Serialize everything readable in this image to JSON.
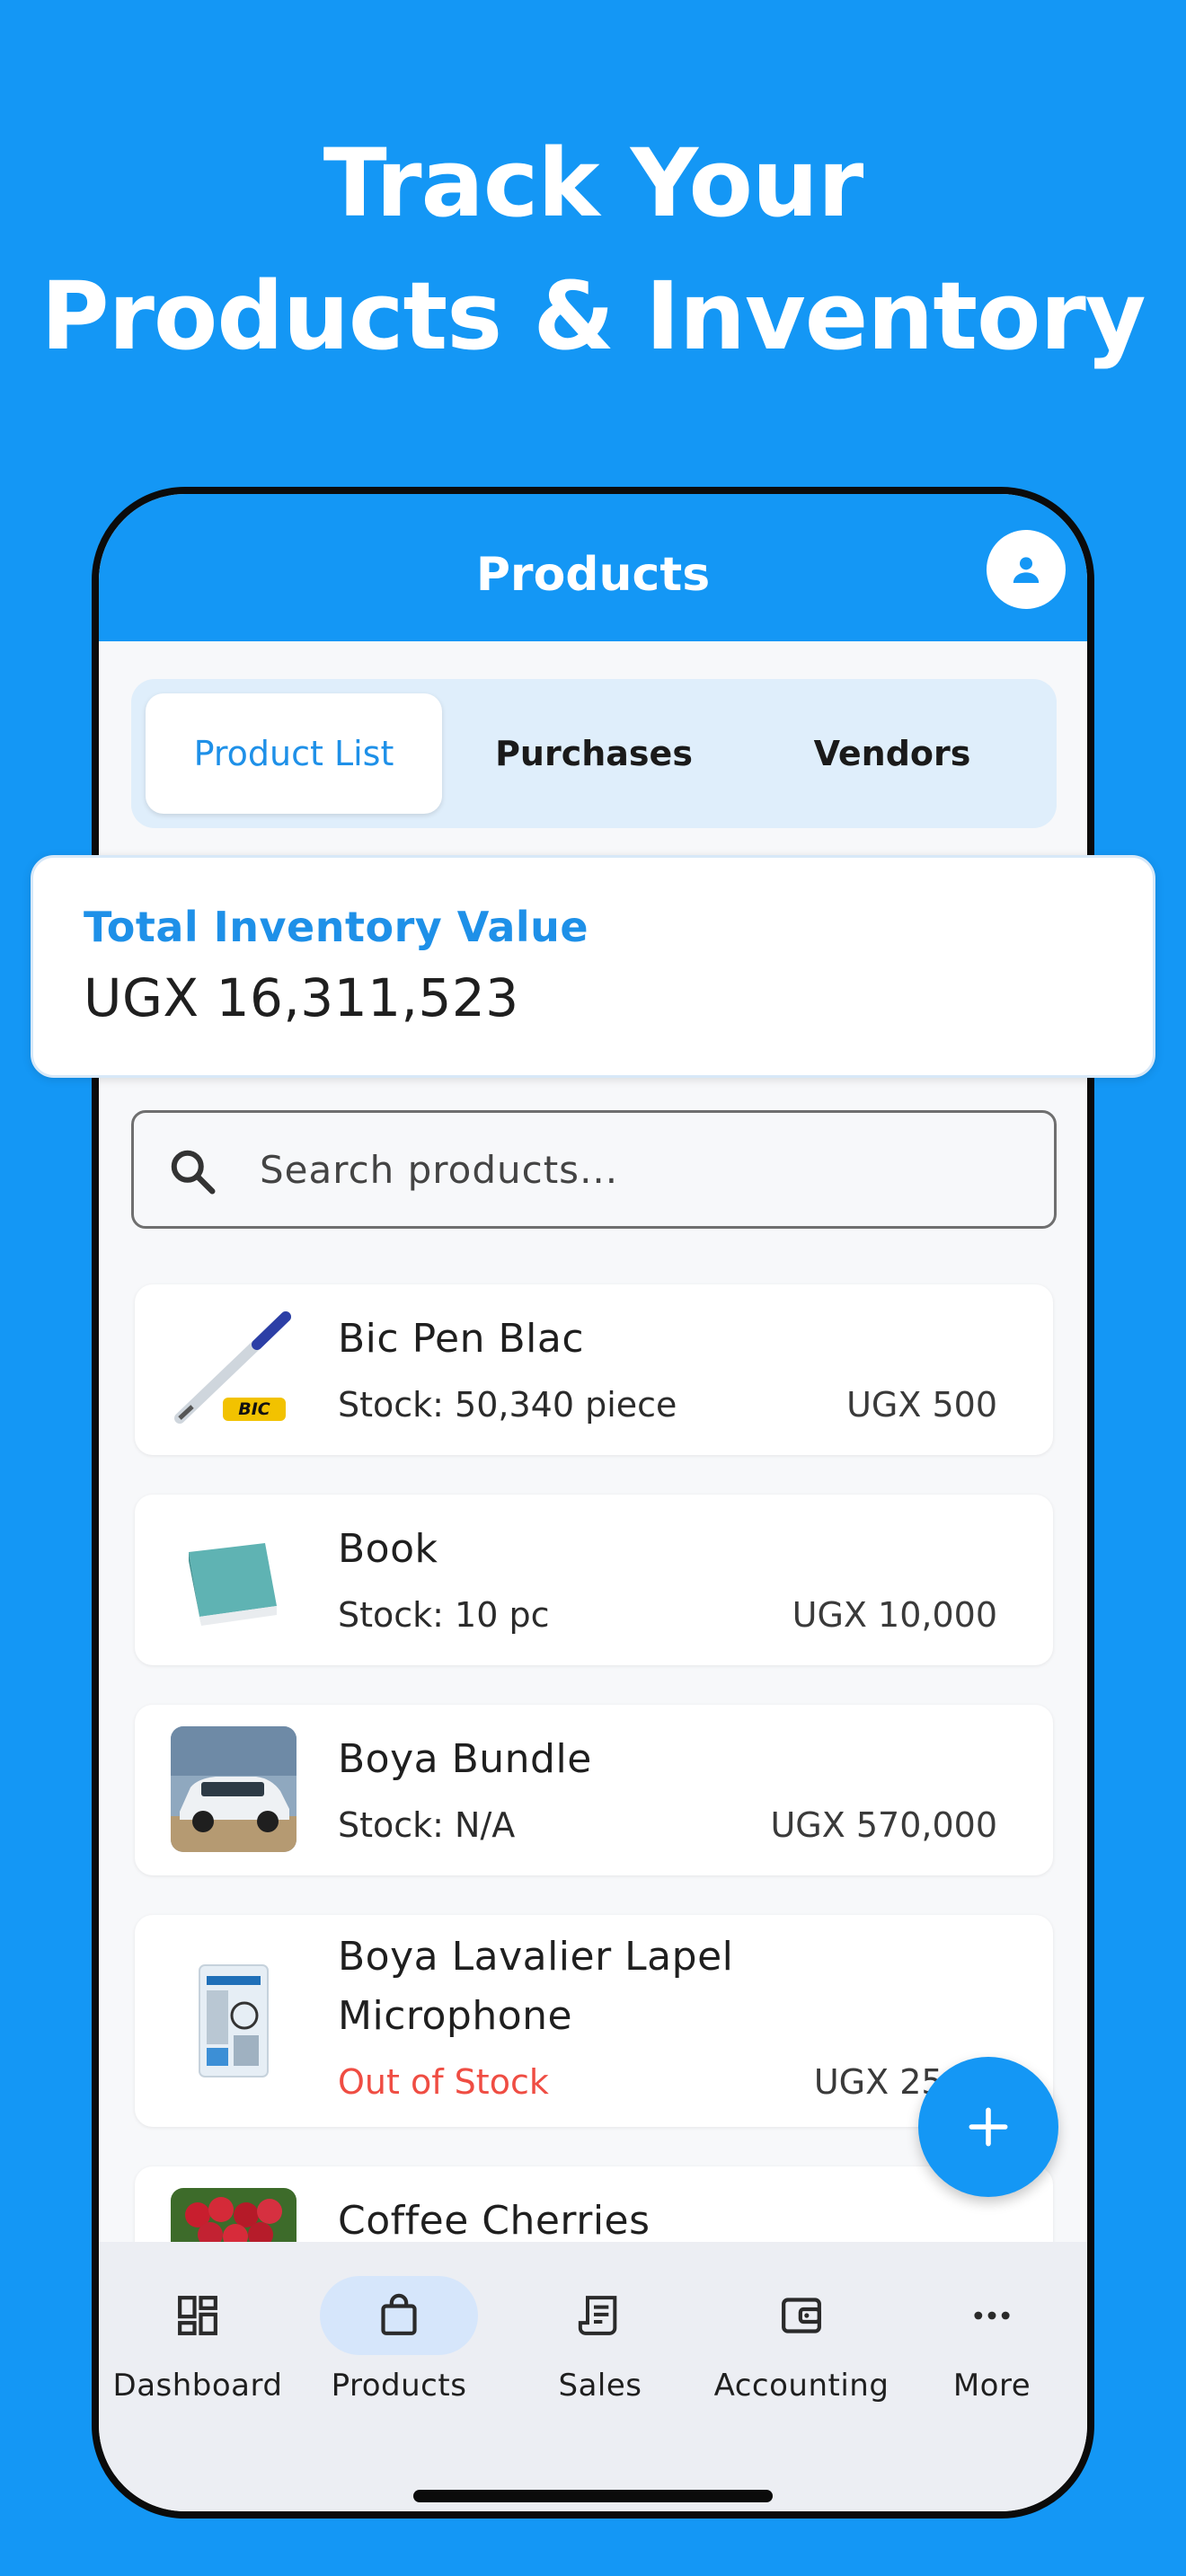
{
  "headline": {
    "line1": "Track Your",
    "line2": "Products & Inventory"
  },
  "appbar": {
    "title": "Products",
    "profile_icon": "person-icon"
  },
  "tabs": [
    {
      "label": "Product List",
      "active": true
    },
    {
      "label": "Purchases",
      "active": false
    },
    {
      "label": "Vendors",
      "active": false
    }
  ],
  "inventory": {
    "label": "Total Inventory Value",
    "value": "UGX 16,311,523"
  },
  "search": {
    "placeholder": "Search products..."
  },
  "products": [
    {
      "name": "Bic Pen Blac",
      "stock": "Stock: 50,340 piece",
      "price": "UGX 500",
      "image": "pen"
    },
    {
      "name": "Book",
      "stock": "Stock: 10 pc",
      "price": "UGX 10,000",
      "image": "book"
    },
    {
      "name": "Boya Bundle",
      "stock": "Stock: N/A",
      "price": "UGX 570,000",
      "image": "car"
    },
    {
      "name_line1": "Boya Lavalier Lapel",
      "name_line2": "Microphone",
      "stock": "Out of Stock",
      "price": "UGX 250,0",
      "image": "microphone-package"
    },
    {
      "name": "Coffee Cherries",
      "image": "coffee-cherries"
    }
  ],
  "fab": {
    "icon": "plus-icon"
  },
  "nav": [
    {
      "label": "Dashboard",
      "icon": "dashboard-icon",
      "active": false
    },
    {
      "label": "Products",
      "icon": "shopping-bag-icon",
      "active": true
    },
    {
      "label": "Sales",
      "icon": "receipt-icon",
      "active": false
    },
    {
      "label": "Accounting",
      "icon": "wallet-icon",
      "active": false
    },
    {
      "label": "More",
      "icon": "more-dots-icon",
      "active": false
    }
  ],
  "colors": {
    "brand": "#1497f5",
    "accent_text": "#1e90e8",
    "out_of_stock": "#ef4d43"
  }
}
